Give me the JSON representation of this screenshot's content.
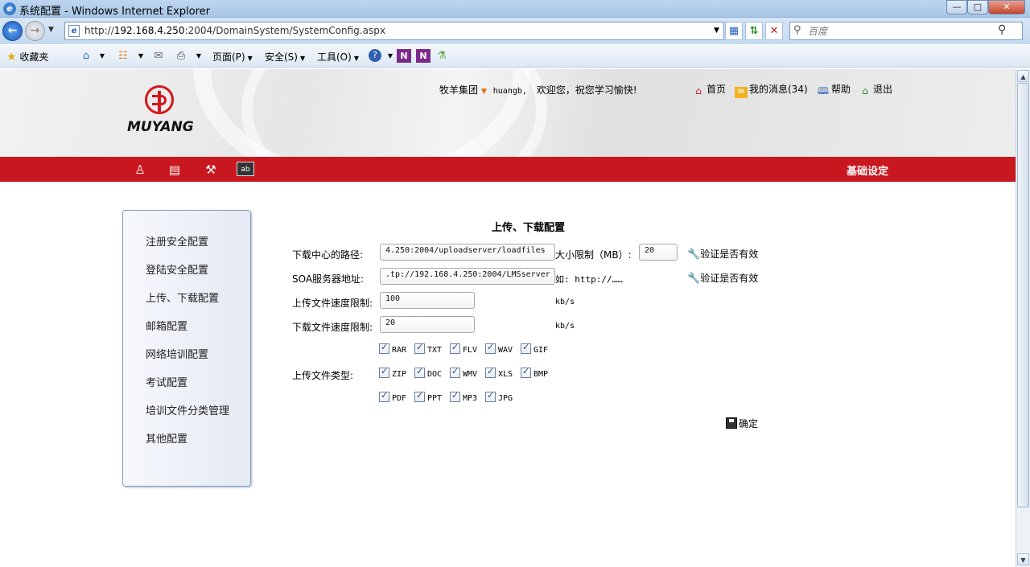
{
  "window": {
    "title": "系统配置 - Windows Internet Explorer",
    "min": "—",
    "max": "□",
    "close": "✕"
  },
  "address_bar": {
    "url_prefix": "http://",
    "url_host": "192.168.4.250",
    "url_rest": ":2004/DomainSystem/SystemConfig.aspx",
    "search_placeholder": "百度"
  },
  "command_bar": {
    "favorites": "收藏夹",
    "page_menu": "页面(P)",
    "safety_menu": "安全(S)",
    "tools_menu": "工具(O)"
  },
  "header": {
    "logo_text": "MUYANG",
    "group": "牧羊集团",
    "username": "huangb,",
    "welcome": "欢迎您，祝您学习愉快!",
    "home": "首页",
    "messages": "我的消息(34)",
    "help": "帮助",
    "logout": "退出",
    "section_title": "基础设定"
  },
  "sidebar": {
    "items": [
      "注册安全配置",
      "登陆安全配置",
      "上传、下载配置",
      "邮箱配置",
      "网络培训配置",
      "考试配置",
      "培训文件分类管理",
      "其他配置"
    ]
  },
  "form": {
    "title": "上传、下载配置",
    "download_path_label": "下载中心的路径:",
    "download_path_value": "4.250:2004/uploadserver/loadfiles",
    "size_limit_label": "大小限制（MB）:",
    "size_limit_value": "20",
    "verify1": "验证是否有效",
    "soa_label": "SOA服务器地址:",
    "soa_value": ".tp://192.168.4.250:2004/LMSserver",
    "soa_hint": "如: http://……",
    "verify2": "验证是否有效",
    "upload_speed_label": "上传文件速度限制:",
    "upload_speed_value": "100",
    "upload_speed_unit": "kb/s",
    "download_speed_label": "下载文件速度限制:",
    "download_speed_value": "20",
    "download_speed_unit": "kb/s",
    "file_types_label": "上传文件类型:",
    "file_types": [
      [
        "RAR",
        "TXT",
        "FLV",
        "WAV",
        "GIF"
      ],
      [
        "ZIP",
        "DOC",
        "WMV",
        "XLS",
        "BMP"
      ],
      [
        "PDF",
        "PPT",
        "MP3",
        "JPG"
      ]
    ],
    "confirm": "确定"
  }
}
